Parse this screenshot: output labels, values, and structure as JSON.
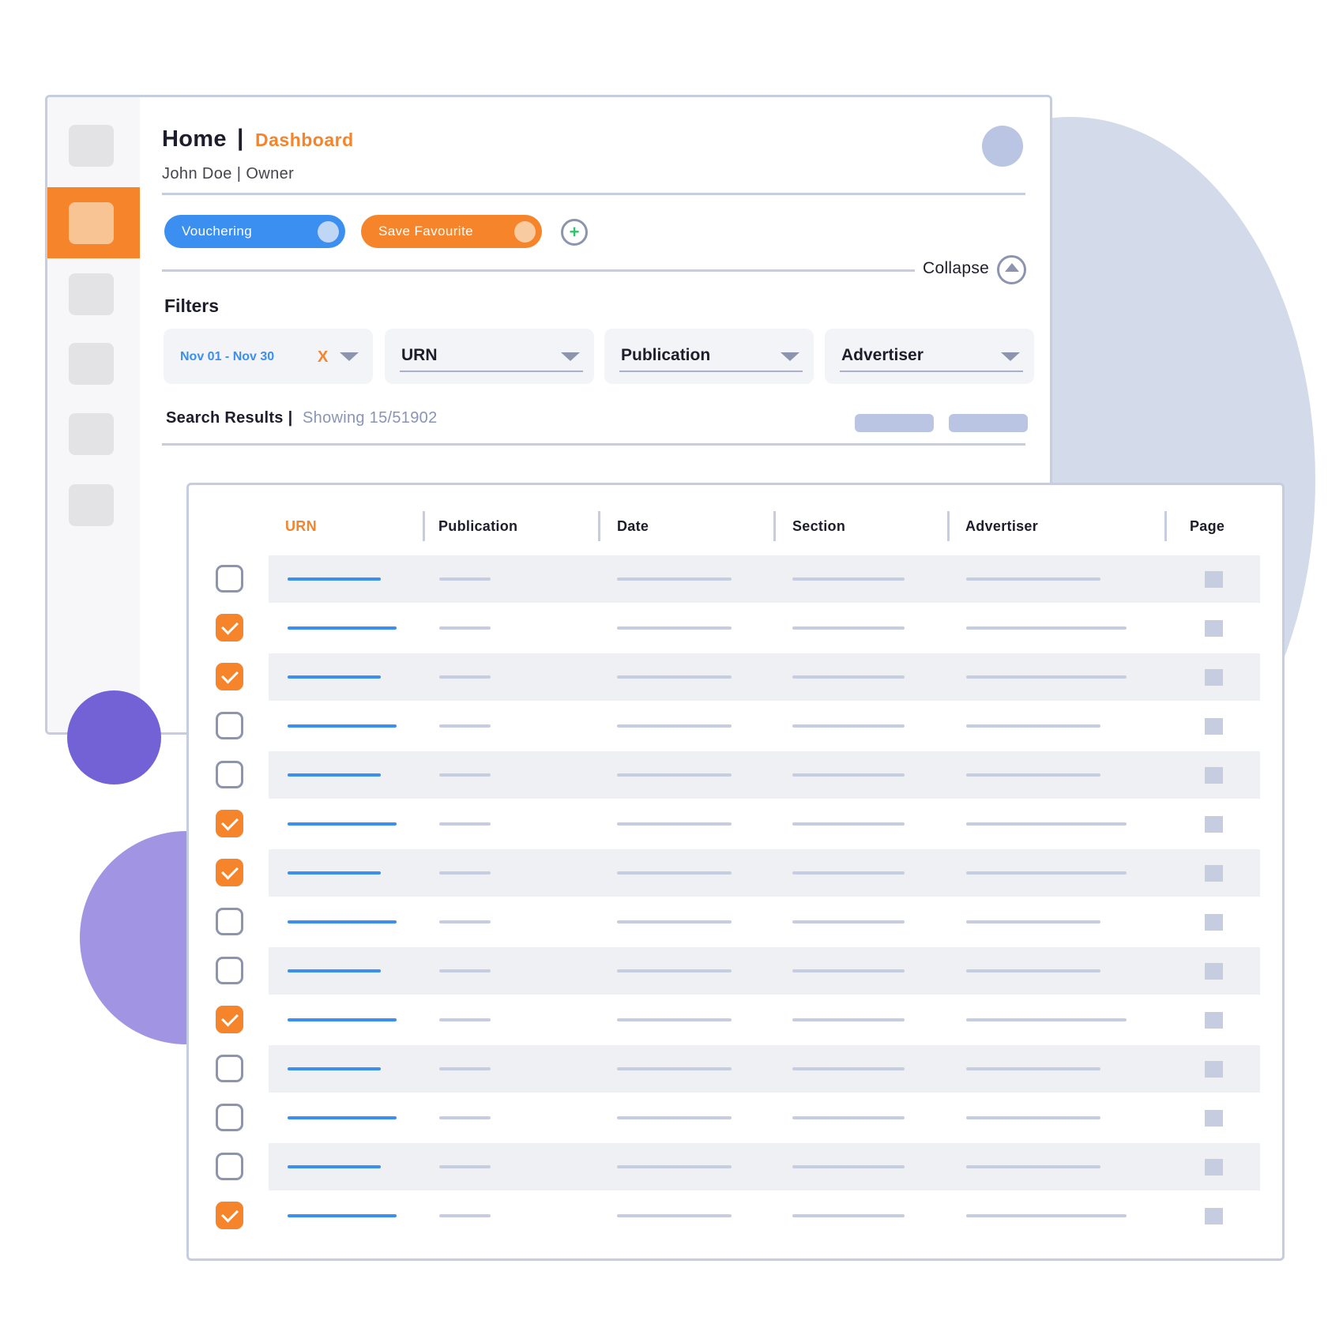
{
  "header": {
    "title": "Home",
    "separator": "|",
    "subtitle": "Dashboard",
    "user_line": "John Doe | Owner"
  },
  "toolbar": {
    "vouchering_label": "Vouchering",
    "save_favourite_label": "Save Favourite",
    "add_icon": "+",
    "collapse_label": "Collapse"
  },
  "filters": {
    "title": "Filters",
    "date_range": "Nov 01 - Nov 30",
    "clear": "X",
    "urn": "URN",
    "publication": "Publication",
    "advertiser": "Advertiser"
  },
  "results": {
    "label": "Search Results |",
    "count": "Showing 15/51902"
  },
  "table": {
    "columns": [
      "URN",
      "Publication",
      "Date",
      "Section",
      "Advertiser",
      "Page"
    ],
    "rows_checked": [
      false,
      true,
      true,
      false,
      false,
      true,
      true,
      false,
      false,
      true,
      false,
      false,
      false,
      true
    ]
  },
  "colors": {
    "accent_orange": "#f5842a",
    "accent_blue": "#3a8ff0",
    "purple": "#7262d6",
    "lilac": "#a195e3",
    "slate": "#c6cde0"
  }
}
